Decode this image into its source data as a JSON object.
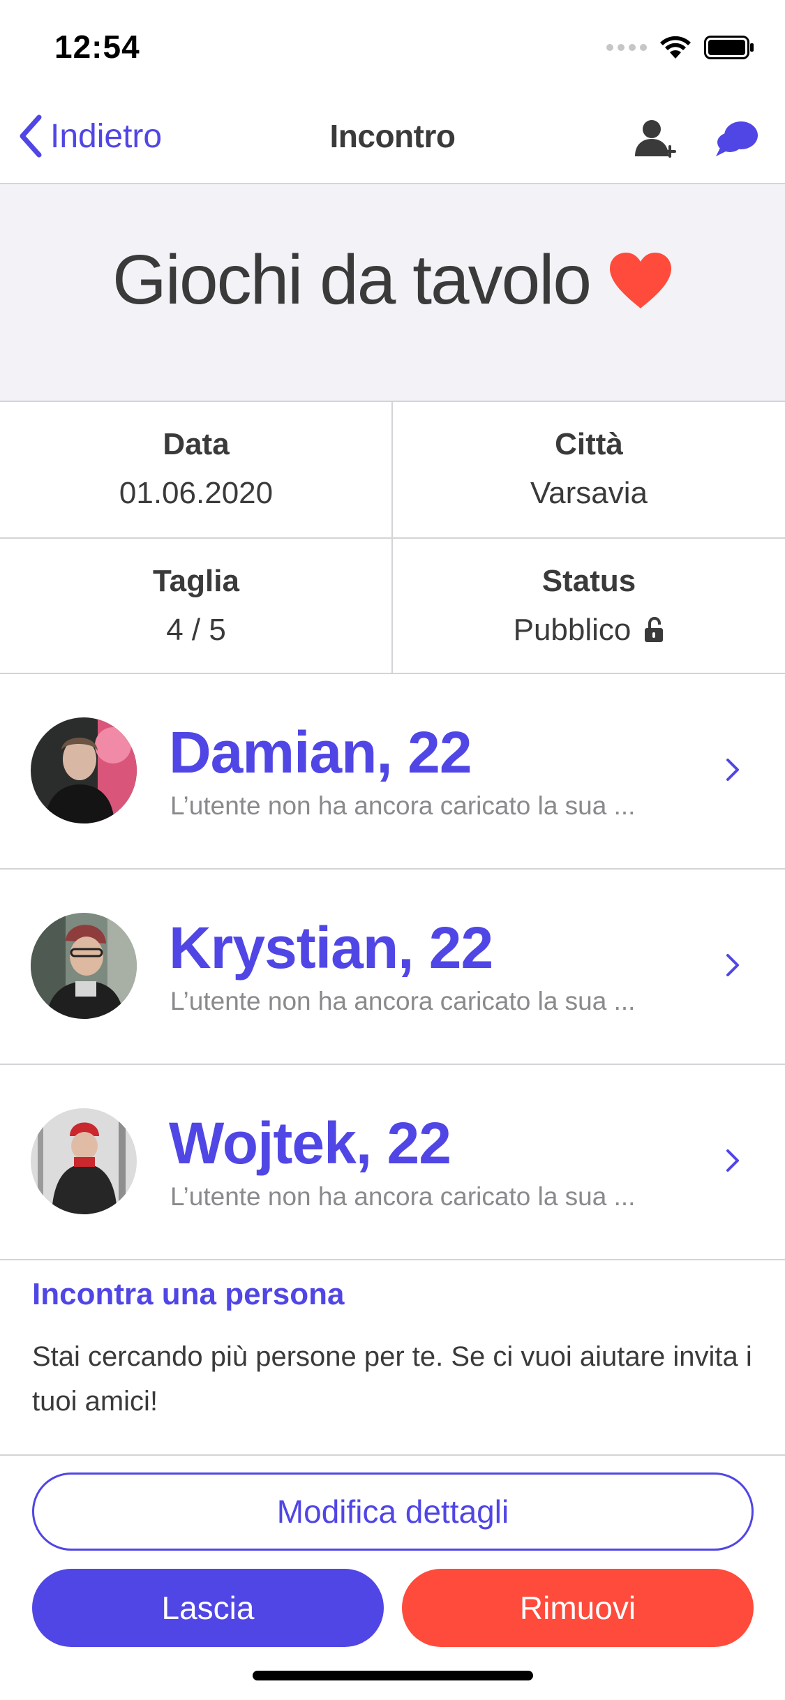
{
  "status_bar": {
    "time": "12:54"
  },
  "nav": {
    "back_label": "Indietro",
    "title": "Incontro",
    "add_person_icon": "add-person-icon",
    "chat_icon": "chat-bubbles-icon"
  },
  "event": {
    "title": "Giochi da tavolo",
    "heart_color": "#ff4b3b"
  },
  "info": {
    "date_label": "Data",
    "date_value": "01.06.2020",
    "city_label": "Città",
    "city_value": "Varsavia",
    "size_label": "Taglia",
    "size_value": "4 / 5",
    "status_label": "Status",
    "status_value": "Pubblico",
    "status_icon": "unlocked-padlock-icon"
  },
  "members": [
    {
      "name": "Damian, 22",
      "subtitle": "L’utente non ha ancora caricato la sua ..."
    },
    {
      "name": "Krystian, 22",
      "subtitle": "L’utente non ha ancora caricato la sua ..."
    },
    {
      "name": "Wojtek, 22",
      "subtitle": "L’utente non ha ancora caricato la sua ..."
    }
  ],
  "invite": {
    "title": "Incontra una persona",
    "text": "Stai cercando più persone per te. Se ci vuoi aiutare invita i tuoi amici!"
  },
  "actions": {
    "edit_label": "Modifica dettagli",
    "leave_label": "Lascia",
    "remove_label": "Rimuovi"
  },
  "colors": {
    "accent": "#5046e5",
    "danger": "#ff4b3b",
    "hero_bg": "#f2f2f7"
  }
}
